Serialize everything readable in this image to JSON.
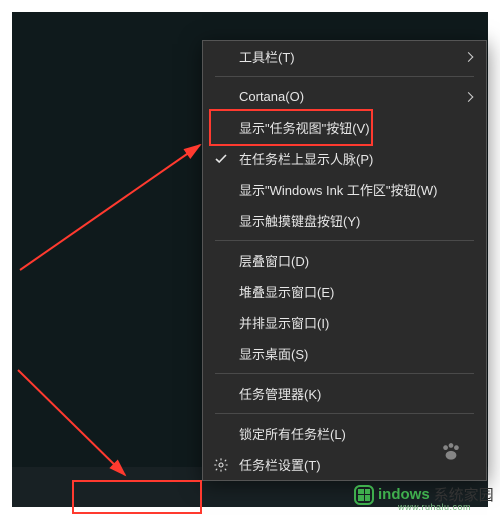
{
  "annotation_color": "#ff3a2f",
  "context_menu": {
    "items": [
      {
        "label": "工具栏(T)",
        "submenu": true
      },
      {
        "sep": true
      },
      {
        "label": "Cortana(O)",
        "submenu": true
      },
      {
        "label": "显示\"任务视图\"按钮(V)",
        "highlighted": true
      },
      {
        "label": "在任务栏上显示人脉(P)",
        "checked": true
      },
      {
        "label": "显示\"Windows Ink 工作区\"按钮(W)"
      },
      {
        "label": "显示触摸键盘按钮(Y)"
      },
      {
        "sep": true
      },
      {
        "label": "层叠窗口(D)"
      },
      {
        "label": "堆叠显示窗口(E)"
      },
      {
        "label": "并排显示窗口(I)"
      },
      {
        "label": "显示桌面(S)"
      },
      {
        "sep": true
      },
      {
        "label": "任务管理器(K)"
      },
      {
        "sep": true
      },
      {
        "label": "锁定所有任务栏(L)"
      },
      {
        "label": "任务栏设置(T)",
        "icon": "gear"
      }
    ]
  },
  "watermark": {
    "brand": "indows",
    "suffix": "系统家园",
    "url": "www.ruhalu.com"
  }
}
